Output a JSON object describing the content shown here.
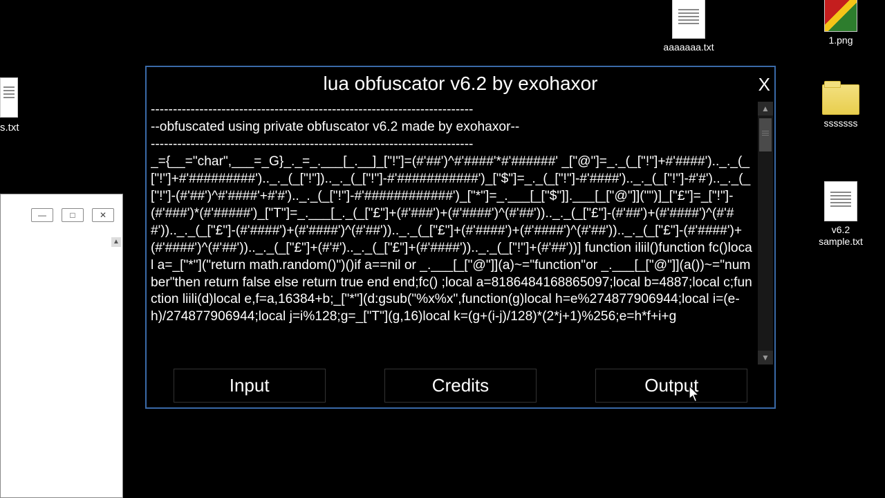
{
  "desktop": {
    "icons": [
      {
        "label": "aaaaaaa.txt",
        "type": "textfile"
      },
      {
        "label": "1.png",
        "type": "imagefile"
      },
      {
        "label": "sssssss",
        "type": "folder"
      },
      {
        "label": "v6.2 sample.txt",
        "type": "textfile"
      }
    ],
    "edge_icon_label": "s.txt"
  },
  "partial_window": {
    "minimize_glyph": "—",
    "restore_glyph": "□",
    "close_glyph": "✕",
    "scroll_up_glyph": "▲"
  },
  "obf": {
    "title": "lua obfuscator v6.2 by exohaxor",
    "close_label": "X",
    "scroll_up_glyph": "▲",
    "scroll_down_glyph": "▼",
    "buttons": {
      "input": "Input",
      "credits": "Credits",
      "output": "Output"
    },
    "output_text": "-------------------------------------------------------------------------\n--obfuscated using private obfuscator v6.2 made by exohaxor--\n-------------------------------------------------------------------------\n_={__=\"char\",___=_G}_._=_.___[_.__]_[\"!\"]=(#'##')^#'####'*#'######' _[\"@\"]=_._(_[\"!\"]+#'####').._._(_[\"!\"]+#'#########').._._(_[\"!\"]).._._(_[\"!\"]-#'###########')_[\"$\"]=_._(_[\"!\"]-#'####').._._(_[\"!\"]-#'#').._._(_[\"!\"]-(#'##')^#'####'+#'#').._._(_[\"!\"]-#'############')_[\"*\"]=_.___[_[\"$\"]].___[_[\"@\"]](\"\")]_[\"£\"]=_[\"!\"]-(#'###')*(#'#####')_[\"T\"]=_.___[_._(_[\"£\"]+(#'###')+(#'####')^(#'##')).._._(_[\"£\"]-(#'##')+(#'####')^(#'##')).._._(_[\"£\"]-(#'####')+(#'####')^(#'##')).._._(_[\"£\"]+(#'####')+(#'####')^(#'##')).._._(_[\"£\"]-(#'####')+(#'####')^(#'##')).._._(_[\"£\"]+(#'#').._._(_[\"£\"]+(#'####')).._._(_[\"!\"]+(#'##'))] function iliil()function fc()local a=_[\"*\"](\"return math.random()\")()if a==nil or _.___[_[\"@\"]](a)~=\"function\"or _.___[_[\"@\"]](a())~=\"number\"then return false else return true end end;fc() ;local a=8186484168865097;local b=4887;local c;function liili(d)local e,f=a,16384+b;_[\"*\"](d:gsub(\"%x%x\",function(g)local h=e%274877906944;local i=(e-h)/274877906944;local j=i%128;g=_[\"T\"](g,16)local k=(g+(i-j)/128)*(2*j+1)%256;e=h*f+i+g"
  }
}
